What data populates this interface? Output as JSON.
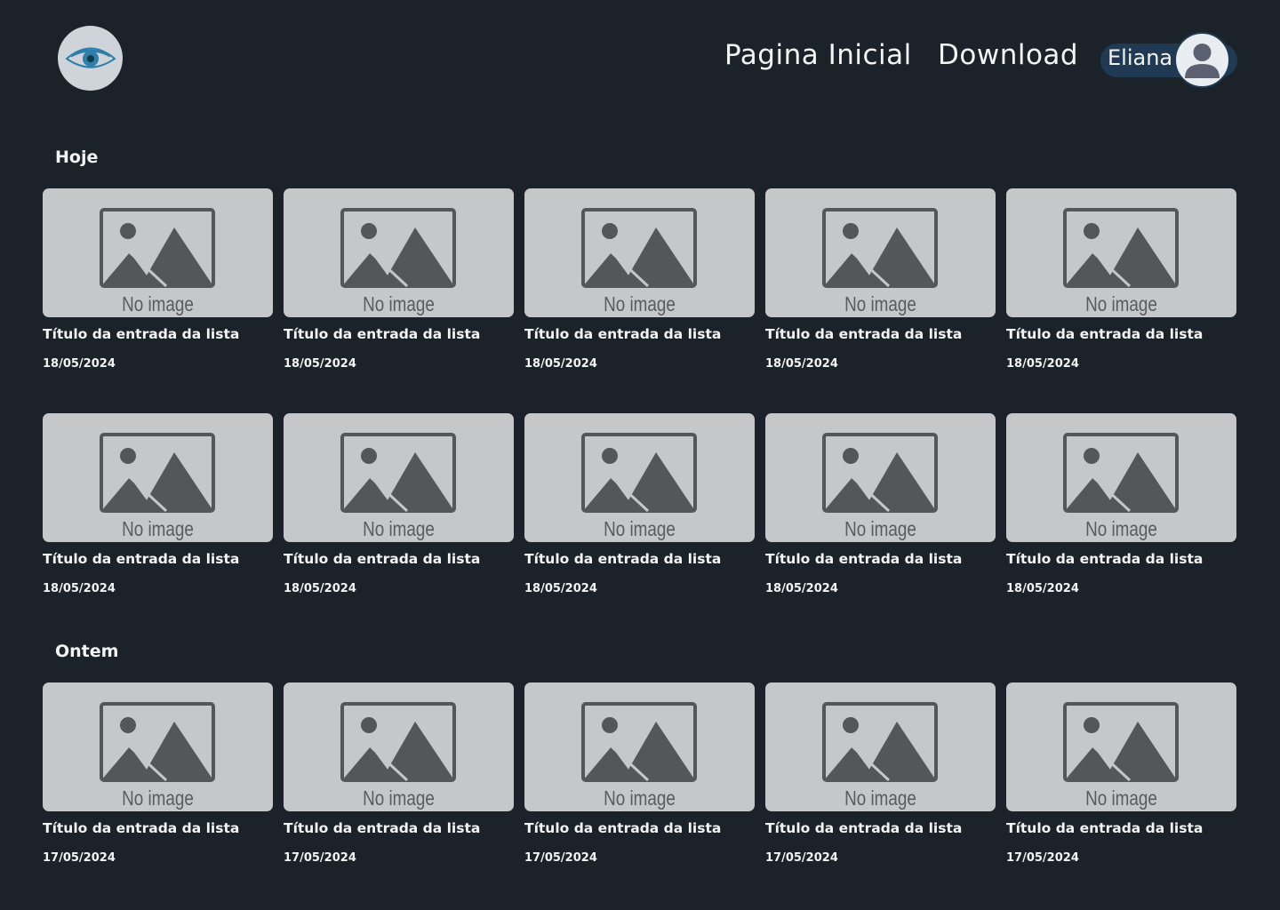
{
  "header": {
    "logo_icon": "eye-icon",
    "nav": [
      {
        "label": "Pagina Inicial"
      },
      {
        "label": "Download"
      }
    ],
    "user": {
      "name": "Eliana",
      "avatar_icon": "user-avatar-icon"
    }
  },
  "placeholder_text": "No image",
  "sections": [
    {
      "title": "Hoje",
      "rows": [
        [
          {
            "title": "Título da entrada da lista",
            "date": "18/05/2024"
          },
          {
            "title": "Título da entrada da lista",
            "date": "18/05/2024"
          },
          {
            "title": "Título da entrada da lista",
            "date": "18/05/2024"
          },
          {
            "title": "Título da entrada da lista",
            "date": "18/05/2024"
          },
          {
            "title": "Título da entrada da lista",
            "date": "18/05/2024"
          }
        ],
        [
          {
            "title": "Título da entrada da lista",
            "date": "18/05/2024"
          },
          {
            "title": "Título da entrada da lista",
            "date": "18/05/2024"
          },
          {
            "title": "Título da entrada da lista",
            "date": "18/05/2024"
          },
          {
            "title": "Título da entrada da lista",
            "date": "18/05/2024"
          },
          {
            "title": "Título da entrada da lista",
            "date": "18/05/2024"
          }
        ]
      ]
    },
    {
      "title": "Ontem",
      "rows": [
        [
          {
            "title": "Título da entrada da lista",
            "date": "17/05/2024"
          },
          {
            "title": "Título da entrada da lista",
            "date": "17/05/2024"
          },
          {
            "title": "Título da entrada da lista",
            "date": "17/05/2024"
          },
          {
            "title": "Título da entrada da lista",
            "date": "17/05/2024"
          },
          {
            "title": "Título da entrada da lista",
            "date": "17/05/2024"
          }
        ]
      ]
    }
  ],
  "colors": {
    "background": "#1c222a",
    "thumb": "#c6c7c9",
    "user_pill": "#1f3a52",
    "logo_eye": "#2e7fa8"
  }
}
